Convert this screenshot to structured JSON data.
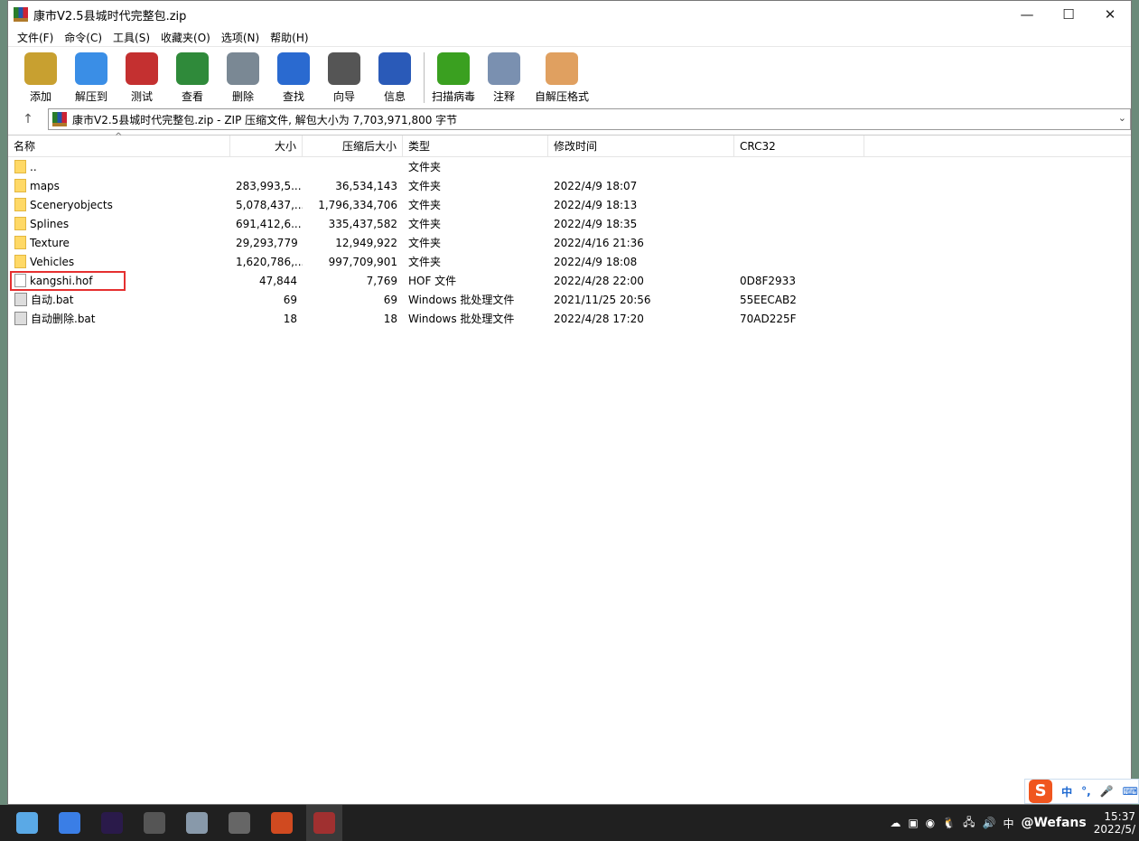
{
  "window": {
    "title": "康市V2.5县城时代完整包.zip",
    "minimize": "—",
    "maximize": "☐",
    "close": "✕"
  },
  "menu": [
    "文件(F)",
    "命令(C)",
    "工具(S)",
    "收藏夹(O)",
    "选项(N)",
    "帮助(H)"
  ],
  "toolbar": [
    {
      "label": "添加",
      "icon": "add-archive-icon",
      "color": "#c8a030"
    },
    {
      "label": "解压到",
      "icon": "extract-folder-icon",
      "color": "#3a8ee6"
    },
    {
      "label": "测试",
      "icon": "test-clipboard-icon",
      "color": "#c43030"
    },
    {
      "label": "查看",
      "icon": "view-book-icon",
      "color": "#2f8a3a"
    },
    {
      "label": "删除",
      "icon": "trash-icon",
      "color": "#7a8894"
    },
    {
      "label": "查找",
      "icon": "magnifier-icon",
      "color": "#2a6ad0"
    },
    {
      "label": "向导",
      "icon": "wizard-wand-icon",
      "color": "#555555"
    },
    {
      "label": "信息",
      "icon": "info-icon",
      "color": "#2a5ab8"
    },
    {
      "label": "扫描病毒",
      "icon": "virus-scan-icon",
      "color": "#3aa020"
    },
    {
      "label": "注释",
      "icon": "comment-icon",
      "color": "#7a90b0"
    },
    {
      "label": "自解压格式",
      "icon": "sfx-box-icon",
      "color": "#e0a060"
    }
  ],
  "address": {
    "up": "↑",
    "text": "康市V2.5县城时代完整包.zip - ZIP 压缩文件, 解包大小为 7,703,971,800 字节"
  },
  "columns": {
    "name": "名称",
    "size": "大小",
    "packed": "压缩后大小",
    "type": "类型",
    "modified": "修改时间",
    "crc": "CRC32"
  },
  "rows": [
    {
      "name": "..",
      "size": "",
      "packed": "",
      "type": "文件夹",
      "modified": "",
      "crc": "",
      "kind": "folder"
    },
    {
      "name": "maps",
      "size": "283,993,5...",
      "packed": "36,534,143",
      "type": "文件夹",
      "modified": "2022/4/9 18:07",
      "crc": "",
      "kind": "folder"
    },
    {
      "name": "Sceneryobjects",
      "size": "5,078,437,...",
      "packed": "1,796,334,706",
      "type": "文件夹",
      "modified": "2022/4/9 18:13",
      "crc": "",
      "kind": "folder"
    },
    {
      "name": "Splines",
      "size": "691,412,6...",
      "packed": "335,437,582",
      "type": "文件夹",
      "modified": "2022/4/9 18:35",
      "crc": "",
      "kind": "folder"
    },
    {
      "name": "Texture",
      "size": "29,293,779",
      "packed": "12,949,922",
      "type": "文件夹",
      "modified": "2022/4/16 21:36",
      "crc": "",
      "kind": "folder"
    },
    {
      "name": "Vehicles",
      "size": "1,620,786,...",
      "packed": "997,709,901",
      "type": "文件夹",
      "modified": "2022/4/9 18:08",
      "crc": "",
      "kind": "folder"
    },
    {
      "name": "kangshi.hof",
      "size": "47,844",
      "packed": "7,769",
      "type": "HOF 文件",
      "modified": "2022/4/28 22:00",
      "crc": "0D8F2933",
      "kind": "file"
    },
    {
      "name": "自动.bat",
      "size": "69",
      "packed": "69",
      "type": "Windows 批处理文件",
      "modified": "2021/11/25 20:56",
      "crc": "55EECAB2",
      "kind": "bat"
    },
    {
      "name": "自动删除.bat",
      "size": "18",
      "packed": "18",
      "type": "Windows 批处理文件",
      "modified": "2022/4/28 17:20",
      "crc": "70AD225F",
      "kind": "bat"
    }
  ],
  "ime": {
    "logo": "S",
    "lang": "中",
    "punct": "°,",
    "mic": "🎤",
    "kbd": "⌨"
  },
  "taskbar": {
    "apps": [
      "#5aa9e6",
      "#3a7ee6",
      "#2a1a4a",
      "#555555",
      "#8899aa",
      "#666666",
      "#d04a20",
      "#a03030"
    ],
    "tray_lang": "中",
    "watermark": "@Wefans",
    "time": "15:37",
    "date": "2022/5/"
  }
}
